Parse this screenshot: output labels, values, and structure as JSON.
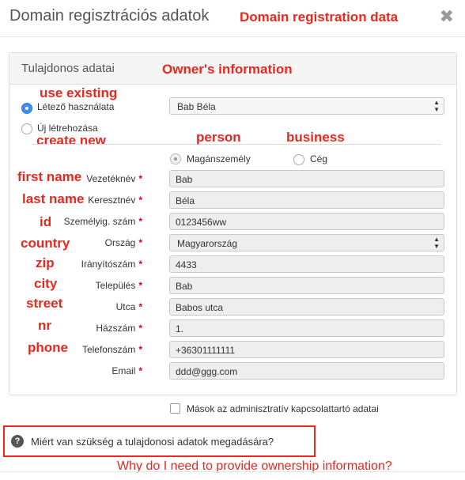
{
  "modal": {
    "title": "Domain regisztrációs adatok",
    "close_glyph": "✖"
  },
  "panel": {
    "heading": "Tulajdonos adatai"
  },
  "owner_source": {
    "use_existing_label": "Létező használata",
    "create_new_label": "Új létrehozása",
    "selected": "use_existing",
    "existing_contact": "Bab Béla"
  },
  "entity_type": {
    "person_label": "Magánszemély",
    "business_label": "Cég",
    "selected": "person"
  },
  "fields": {
    "last_name": {
      "label": "Vezetéknév",
      "value": "Bab",
      "required": "*"
    },
    "first_name": {
      "label": "Keresztnév",
      "value": "Béla",
      "required": "*"
    },
    "id_number": {
      "label": "Személyig. szám",
      "value": "0123456ww",
      "required": "*"
    },
    "country": {
      "label": "Ország",
      "value": "Magyarország",
      "required": "*"
    },
    "zip": {
      "label": "Irányítószám",
      "value": "4433",
      "required": "*"
    },
    "city": {
      "label": "Település",
      "value": "Bab",
      "required": "*"
    },
    "street": {
      "label": "Utca",
      "value": "Babos utca",
      "required": "*"
    },
    "house_nr": {
      "label": "Házszám",
      "value": "1.",
      "required": "*"
    },
    "phone": {
      "label": "Telefonszám",
      "value": "+36301111111",
      "required": "*"
    },
    "email": {
      "label": "Email",
      "value": "ddd@ggg.com",
      "required": "*"
    }
  },
  "admin_copy": {
    "label": "Mások az adminisztratív kapcsolattartó adatai",
    "checked": false
  },
  "help": {
    "icon": "?",
    "text": "Miért van szükség a tulajdonosi adatok megadására?"
  },
  "annotations": {
    "title": "Domain registration data",
    "owner_info": "Owner's information",
    "use_existing": "use existing",
    "create_new": "create new",
    "person": "person",
    "business": "business",
    "first_name": "first name",
    "last_name": "last name",
    "id": "id",
    "country": "country",
    "zip": "zip",
    "city": "city",
    "street": "street",
    "nr": "nr",
    "phone": "phone",
    "question": "Why do I need to provide ownership information?"
  },
  "colors": {
    "annotation_red": "#e8281e",
    "radio_blue": "#3b8ff1",
    "required_red": "#d0021b"
  }
}
